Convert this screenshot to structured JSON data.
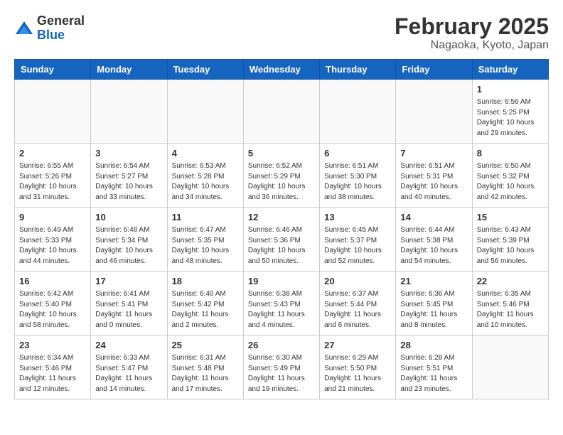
{
  "logo": {
    "general": "General",
    "blue": "Blue"
  },
  "header": {
    "month": "February 2025",
    "location": "Nagaoka, Kyoto, Japan"
  },
  "weekdays": [
    "Sunday",
    "Monday",
    "Tuesday",
    "Wednesday",
    "Thursday",
    "Friday",
    "Saturday"
  ],
  "weeks": [
    [
      {
        "day": "",
        "info": ""
      },
      {
        "day": "",
        "info": ""
      },
      {
        "day": "",
        "info": ""
      },
      {
        "day": "",
        "info": ""
      },
      {
        "day": "",
        "info": ""
      },
      {
        "day": "",
        "info": ""
      },
      {
        "day": "1",
        "info": "Sunrise: 6:56 AM\nSunset: 5:25 PM\nDaylight: 10 hours\nand 29 minutes."
      }
    ],
    [
      {
        "day": "2",
        "info": "Sunrise: 6:55 AM\nSunset: 5:26 PM\nDaylight: 10 hours\nand 31 minutes."
      },
      {
        "day": "3",
        "info": "Sunrise: 6:54 AM\nSunset: 5:27 PM\nDaylight: 10 hours\nand 33 minutes."
      },
      {
        "day": "4",
        "info": "Sunrise: 6:53 AM\nSunset: 5:28 PM\nDaylight: 10 hours\nand 34 minutes."
      },
      {
        "day": "5",
        "info": "Sunrise: 6:52 AM\nSunset: 5:29 PM\nDaylight: 10 hours\nand 36 minutes."
      },
      {
        "day": "6",
        "info": "Sunrise: 6:51 AM\nSunset: 5:30 PM\nDaylight: 10 hours\nand 38 minutes."
      },
      {
        "day": "7",
        "info": "Sunrise: 6:51 AM\nSunset: 5:31 PM\nDaylight: 10 hours\nand 40 minutes."
      },
      {
        "day": "8",
        "info": "Sunrise: 6:50 AM\nSunset: 5:32 PM\nDaylight: 10 hours\nand 42 minutes."
      }
    ],
    [
      {
        "day": "9",
        "info": "Sunrise: 6:49 AM\nSunset: 5:33 PM\nDaylight: 10 hours\nand 44 minutes."
      },
      {
        "day": "10",
        "info": "Sunrise: 6:48 AM\nSunset: 5:34 PM\nDaylight: 10 hours\nand 46 minutes."
      },
      {
        "day": "11",
        "info": "Sunrise: 6:47 AM\nSunset: 5:35 PM\nDaylight: 10 hours\nand 48 minutes."
      },
      {
        "day": "12",
        "info": "Sunrise: 6:46 AM\nSunset: 5:36 PM\nDaylight: 10 hours\nand 50 minutes."
      },
      {
        "day": "13",
        "info": "Sunrise: 6:45 AM\nSunset: 5:37 PM\nDaylight: 10 hours\nand 52 minutes."
      },
      {
        "day": "14",
        "info": "Sunrise: 6:44 AM\nSunset: 5:38 PM\nDaylight: 10 hours\nand 54 minutes."
      },
      {
        "day": "15",
        "info": "Sunrise: 6:43 AM\nSunset: 5:39 PM\nDaylight: 10 hours\nand 56 minutes."
      }
    ],
    [
      {
        "day": "16",
        "info": "Sunrise: 6:42 AM\nSunset: 5:40 PM\nDaylight: 10 hours\nand 58 minutes."
      },
      {
        "day": "17",
        "info": "Sunrise: 6:41 AM\nSunset: 5:41 PM\nDaylight: 11 hours\nand 0 minutes."
      },
      {
        "day": "18",
        "info": "Sunrise: 6:40 AM\nSunset: 5:42 PM\nDaylight: 11 hours\nand 2 minutes."
      },
      {
        "day": "19",
        "info": "Sunrise: 6:38 AM\nSunset: 5:43 PM\nDaylight: 11 hours\nand 4 minutes."
      },
      {
        "day": "20",
        "info": "Sunrise: 6:37 AM\nSunset: 5:44 PM\nDaylight: 11 hours\nand 6 minutes."
      },
      {
        "day": "21",
        "info": "Sunrise: 6:36 AM\nSunset: 5:45 PM\nDaylight: 11 hours\nand 8 minutes."
      },
      {
        "day": "22",
        "info": "Sunrise: 6:35 AM\nSunset: 5:46 PM\nDaylight: 11 hours\nand 10 minutes."
      }
    ],
    [
      {
        "day": "23",
        "info": "Sunrise: 6:34 AM\nSunset: 5:46 PM\nDaylight: 11 hours\nand 12 minutes."
      },
      {
        "day": "24",
        "info": "Sunrise: 6:33 AM\nSunset: 5:47 PM\nDaylight: 11 hours\nand 14 minutes."
      },
      {
        "day": "25",
        "info": "Sunrise: 6:31 AM\nSunset: 5:48 PM\nDaylight: 11 hours\nand 17 minutes."
      },
      {
        "day": "26",
        "info": "Sunrise: 6:30 AM\nSunset: 5:49 PM\nDaylight: 11 hours\nand 19 minutes."
      },
      {
        "day": "27",
        "info": "Sunrise: 6:29 AM\nSunset: 5:50 PM\nDaylight: 11 hours\nand 21 minutes."
      },
      {
        "day": "28",
        "info": "Sunrise: 6:28 AM\nSunset: 5:51 PM\nDaylight: 11 hours\nand 23 minutes."
      },
      {
        "day": "",
        "info": ""
      }
    ]
  ]
}
